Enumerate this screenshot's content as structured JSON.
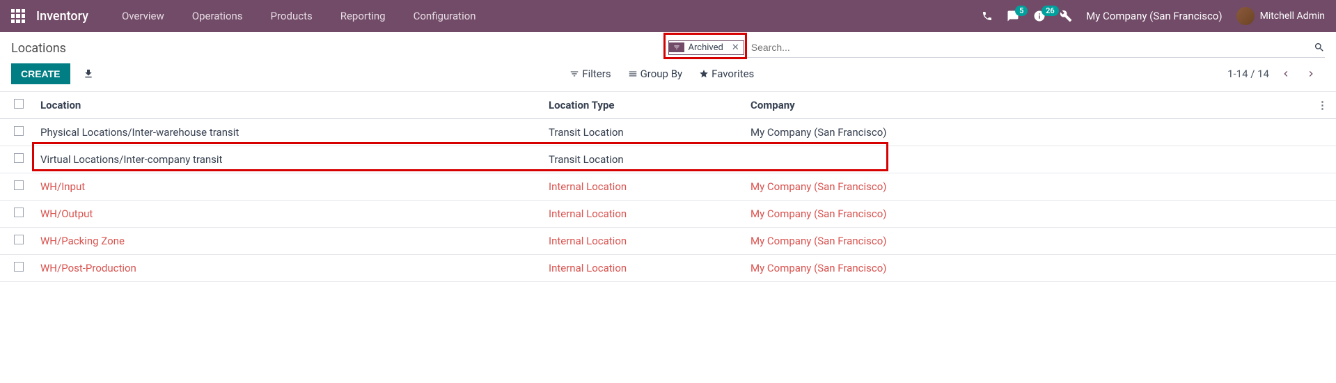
{
  "topbar": {
    "brand": "Inventory",
    "nav": [
      "Overview",
      "Operations",
      "Products",
      "Reporting",
      "Configuration"
    ],
    "msg_badge": "5",
    "activity_badge": "26",
    "company": "My Company (San Francisco)",
    "user": "Mitchell Admin"
  },
  "page": {
    "title": "Locations",
    "filter_tag": "Archived",
    "search_placeholder": "Search...",
    "create_label": "CREATE",
    "filters_label": "Filters",
    "groupby_label": "Group By",
    "favorites_label": "Favorites",
    "pager": "1-14 / 14"
  },
  "table": {
    "headers": {
      "location": "Location",
      "type": "Location Type",
      "company": "Company"
    },
    "rows": [
      {
        "location": "Physical Locations/Inter-warehouse transit",
        "type": "Transit Location",
        "company": "My Company (San Francisco)",
        "archived": false
      },
      {
        "location": "Virtual Locations/Inter-company transit",
        "type": "Transit Location",
        "company": "",
        "archived": false
      },
      {
        "location": "WH/Input",
        "type": "Internal Location",
        "company": "My Company (San Francisco)",
        "archived": true
      },
      {
        "location": "WH/Output",
        "type": "Internal Location",
        "company": "My Company (San Francisco)",
        "archived": true
      },
      {
        "location": "WH/Packing Zone",
        "type": "Internal Location",
        "company": "My Company (San Francisco)",
        "archived": true
      },
      {
        "location": "WH/Post-Production",
        "type": "Internal Location",
        "company": "My Company (San Francisco)",
        "archived": true
      }
    ]
  }
}
